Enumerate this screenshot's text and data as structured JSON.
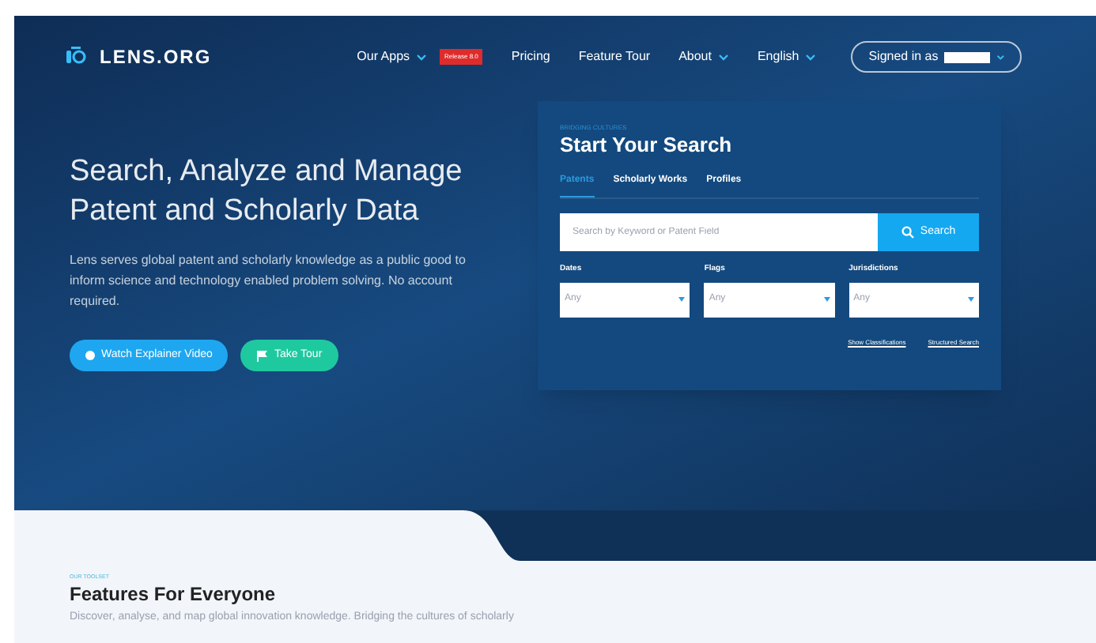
{
  "header": {
    "logo": "LENS.ORG",
    "nav": [
      {
        "label": "Our Apps",
        "caret": true,
        "badge": "Release 8.0"
      },
      {
        "label": "Pricing",
        "caret": false
      },
      {
        "label": "Feature Tour",
        "caret": false
      },
      {
        "label": "About",
        "caret": true
      },
      {
        "label": "English",
        "caret": true
      }
    ],
    "account": "Signed in as"
  },
  "hero": {
    "title": "Search, Analyze and Manage Patent and Scholarly Data",
    "text": "Lens serves global patent and scholarly knowledge as a public good to inform science and technology enabled problem solving. No account required.",
    "buttons": [
      {
        "label": "Watch Explainer Video",
        "kind": "video"
      },
      {
        "label": "Take Tour",
        "kind": "tour"
      }
    ]
  },
  "search_card": {
    "eyebrow": "BRIDGING CULTURES",
    "title": "Start Your Search",
    "tabs": [
      {
        "label": "Patents",
        "selected": true
      },
      {
        "label": "Scholarly Works",
        "selected": false
      },
      {
        "label": "Profiles",
        "selected": false
      }
    ],
    "placeholder": "Search by Keyword or Patent Field",
    "button": "Search",
    "filters": [
      {
        "label": "Dates",
        "value": "Any"
      },
      {
        "label": "Flags",
        "value": "Any"
      },
      {
        "label": "Jurisdictions",
        "value": "Any"
      }
    ],
    "links": [
      "Show Classifications",
      "Structured Search"
    ]
  },
  "features": {
    "eyebrow": "OUR TOOLSET",
    "title": "Features For Everyone",
    "text": "Discover, analyse, and map global innovation knowledge. Bridging the cultures of scholarly"
  }
}
